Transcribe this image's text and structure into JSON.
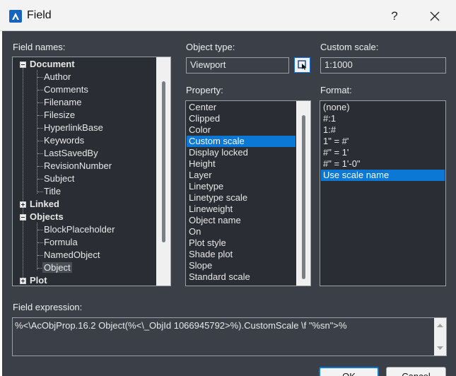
{
  "window": {
    "title": "Field",
    "help": "?",
    "close": "✕"
  },
  "labels": {
    "field_names": "Field names:",
    "object_type": "Object type:",
    "custom_scale": "Custom scale:",
    "property": "Property:",
    "format": "Format:",
    "field_expression": "Field expression:"
  },
  "tree": {
    "groups": [
      {
        "label": "Document",
        "state": "expanded"
      },
      {
        "label": "Linked",
        "state": "collapsed"
      },
      {
        "label": "Objects",
        "state": "expanded"
      },
      {
        "label": "Plot",
        "state": "collapsed"
      }
    ],
    "document_children": [
      "Author",
      "Comments",
      "Filename",
      "Filesize",
      "HyperlinkBase",
      "Keywords",
      "LastSavedBy",
      "RevisionNumber",
      "Subject",
      "Title"
    ],
    "objects_children": [
      "BlockPlaceholder",
      "Formula",
      "NamedObject",
      "Object"
    ],
    "selected": "Object"
  },
  "object_type": {
    "value": "Viewport"
  },
  "custom_scale": {
    "value": "1:1000"
  },
  "property": {
    "items": [
      "Center",
      "Clipped",
      "Color",
      "Custom scale",
      "Display locked",
      "Height",
      "Layer",
      "Linetype",
      "Linetype scale",
      "Lineweight",
      "Object name",
      "On",
      "Plot style",
      "Shade plot",
      "Slope",
      "Standard scale"
    ],
    "selected": "Custom scale"
  },
  "format": {
    "items": [
      "(none)",
      "#:1",
      "1:#",
      "1\" = #'",
      "#\" = 1'",
      "#\" = 1'-0\"",
      "Use scale name"
    ],
    "selected": "Use scale name"
  },
  "field_expression": {
    "value": "%<\\AcObjProp.16.2 Object(%<\\_ObjId 1066945792>%).CustomScale \\f \"%sn\">%"
  },
  "buttons": {
    "ok": "OK",
    "cancel": "Cancel"
  },
  "colors": {
    "dialog_bg": "#3b4048",
    "list_bg": "#2a2d33",
    "selection": "#0a78d4"
  }
}
